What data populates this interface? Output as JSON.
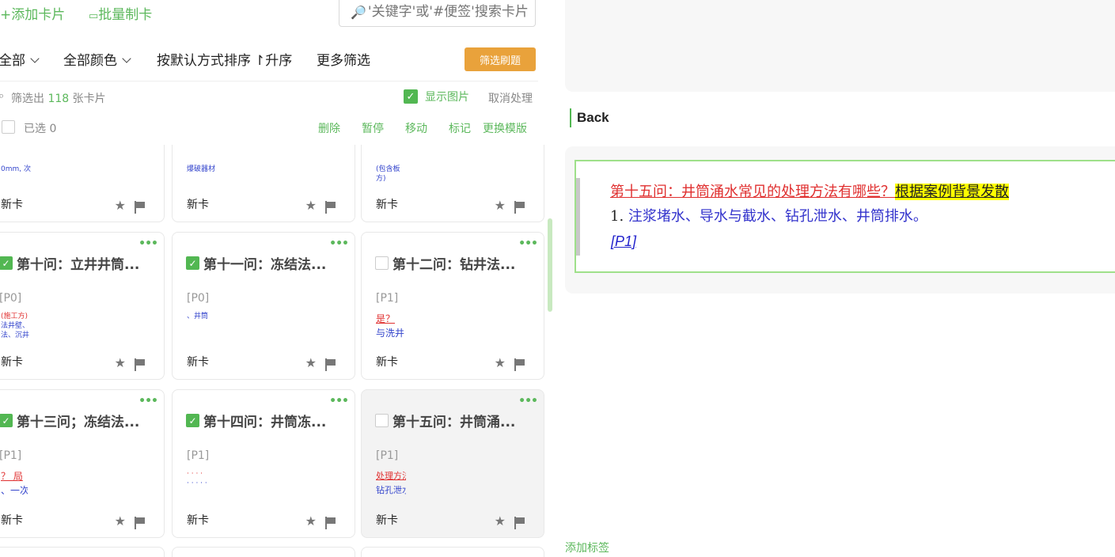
{
  "toolbar": {
    "add_card": "+添加卡片",
    "batch_make": "批量制卡",
    "search_placeholder": "'关键字'或'#便签'搜索卡片"
  },
  "filters": {
    "scope": "全部",
    "color": "全部颜色",
    "sort": "按默认方式排序",
    "order": "↾升序",
    "more": "更多筛选",
    "refresh_button": "筛选刷题"
  },
  "stats": {
    "prefix": "筛选出",
    "count": "118",
    "suffix": "张卡片",
    "show_images": "显示图片",
    "cancel_processing": "取消处理"
  },
  "selection": {
    "selected_label": "已选 0",
    "actions": [
      "删除",
      "暂停",
      "移动",
      "标记",
      "更换模版"
    ]
  },
  "cards_top_row": [
    {
      "thumb_text": "0mm, 次",
      "footer": "新卡"
    },
    {
      "thumb_text": "爆破器材",
      "footer": "新卡"
    },
    {
      "thumb_text": "(包含板\n方)",
      "footer": "新卡"
    }
  ],
  "cards": [
    {
      "title": "第十问：立井井筒...",
      "checked": true,
      "priority": "[P0]",
      "thumb_lines": [
        "(施工方)",
        "法井壁、",
        "法、沉井"
      ],
      "footer": "新卡"
    },
    {
      "title": "第十一问：冻结法...",
      "checked": true,
      "priority": "[P0]",
      "thumb_lines": [
        "",
        "、井筒"
      ],
      "footer": "新卡"
    },
    {
      "title": "第十二问：钻井法...",
      "checked": false,
      "priority": "[P1]",
      "thumb_lines": [
        "是？",
        "与洗井"
      ],
      "footer": "新卡"
    },
    {
      "title": "第十三问；冻结法...",
      "checked": true,
      "priority": "[P1]",
      "thumb_lines": [
        "？ 局",
        "、一次"
      ],
      "footer": "新卡"
    },
    {
      "title": "第十四问：井筒冻...",
      "checked": true,
      "priority": "[P1]",
      "thumb_lines": [
        "· · · ·",
        "· · · · ·"
      ],
      "footer": "新卡"
    },
    {
      "title": "第十五问：井筒涌...",
      "checked": false,
      "priority": "[P1]",
      "thumb_lines": [
        "处理方法",
        "钻孔泄水"
      ],
      "footer": "新卡"
    }
  ],
  "detail": {
    "back_label": "Back",
    "question": "第十五问：井筒涌水常见的处理方法有哪些？",
    "question_highlight": "根据案例背景发散",
    "answer_number": "1.",
    "answer": "注浆堵水、导水与截水、钻孔泄水、井筒排水。",
    "priority_tag": "[P1]",
    "add_tag": "添加标签"
  },
  "colors": {
    "accent_green": "#5cb85c",
    "refresh_orange": "#e9a23b",
    "question_red": "#e03030",
    "highlight_yellow": "#ffff00",
    "answer_blue": "#3333cc"
  }
}
